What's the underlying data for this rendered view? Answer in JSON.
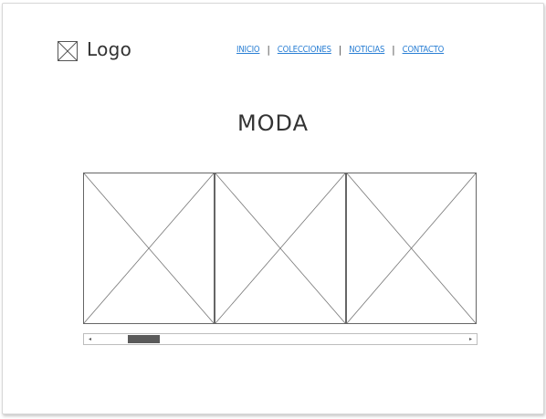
{
  "header": {
    "logo_text": "Logo",
    "logo_icon": "image-placeholder-icon"
  },
  "nav": {
    "items": [
      {
        "label": "Inicio"
      },
      {
        "label": "Colecciones"
      },
      {
        "label": "Noticias"
      },
      {
        "label": "Contacto"
      }
    ],
    "separator": "|"
  },
  "main": {
    "title": "MODA"
  },
  "carousel": {
    "slides": [
      {
        "icon": "image-placeholder-icon"
      },
      {
        "icon": "image-placeholder-icon"
      },
      {
        "icon": "image-placeholder-icon"
      }
    ],
    "scroll_left_glyph": "◂",
    "scroll_right_glyph": "▸",
    "scroll_position": 0.11
  }
}
